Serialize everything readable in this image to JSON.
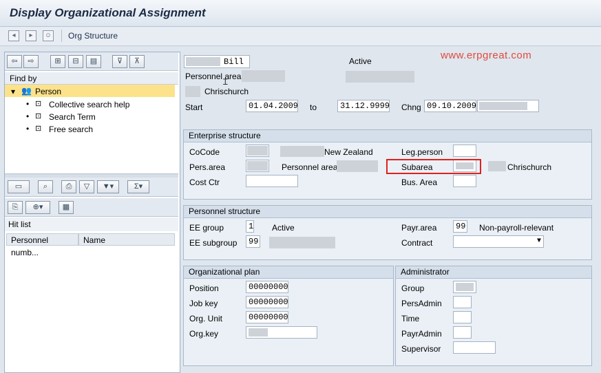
{
  "window": {
    "title": "Display Organizational Assignment"
  },
  "toolbar": {
    "org_structure_label": "Org Structure"
  },
  "left": {
    "find_by_label": "Find by",
    "tree": {
      "root": "Person",
      "children": [
        "Collective search help",
        "Search Term",
        "Free search"
      ]
    },
    "hit_list_label": "Hit list",
    "columns": [
      "Personnel numb...",
      "Name"
    ]
  },
  "header": {
    "name": "Bill",
    "status": "Active",
    "personnel_area_label": "Personnel area",
    "location": "Chrischurch",
    "start_label": "Start",
    "start_date": "01.04.2009",
    "to_label": "to",
    "end_date": "31.12.9999",
    "chng_label": "Chng",
    "chng_date": "09.10.2009"
  },
  "watermark": "www.erpgreat.com",
  "enterprise": {
    "title": "Enterprise structure",
    "cocode_label": "CoCode",
    "cocode_text": "New Zealand",
    "leg_person_label": "Leg.person",
    "pers_area_label": "Pers.area",
    "personnel_area_label": "Personnel area",
    "subarea_label": "Subarea",
    "subarea_text": "Chrischurch",
    "cost_ctr_label": "Cost Ctr",
    "bus_area_label": "Bus. Area"
  },
  "personnel": {
    "title": "Personnel structure",
    "ee_group_label": "EE group",
    "ee_group_value": "1",
    "ee_group_text": "Active",
    "payr_area_label": "Payr.area",
    "payr_area_value": "99",
    "payr_area_text": "Non-payroll-relevant",
    "ee_subgroup_label": "EE subgroup",
    "ee_subgroup_value": "99",
    "contract_label": "Contract"
  },
  "orgplan": {
    "title": "Organizational plan",
    "position_label": "Position",
    "position_value": "00000000",
    "job_key_label": "Job key",
    "job_key_value": "00000000",
    "org_unit_label": "Org. Unit",
    "org_unit_value": "00000000",
    "org_key_label": "Org.key"
  },
  "admin": {
    "title": "Administrator",
    "group_label": "Group",
    "persadmin_label": "PersAdmin",
    "time_label": "Time",
    "payradmin_label": "PayrAdmin",
    "supervisor_label": "Supervisor"
  }
}
